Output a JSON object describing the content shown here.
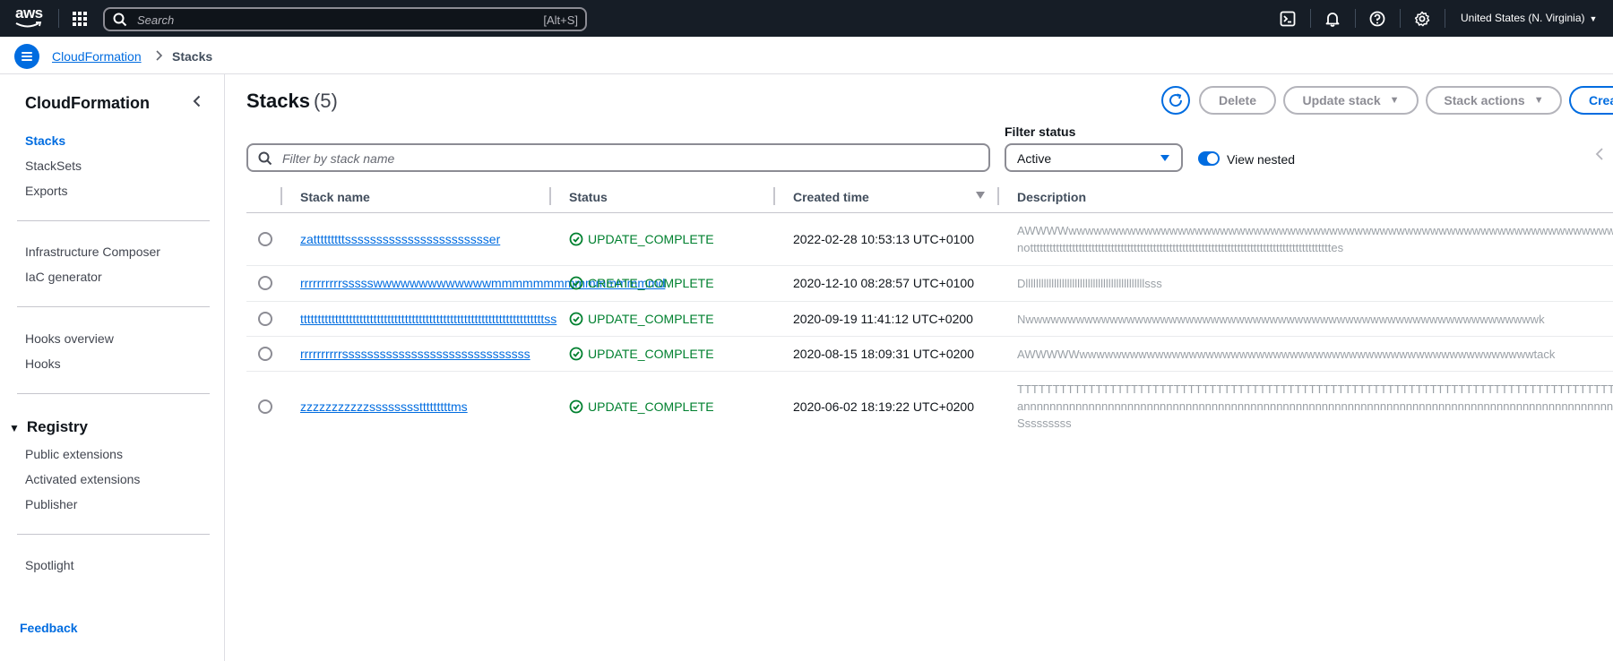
{
  "nav": {
    "logo": "aws",
    "search_placeholder": "Search",
    "search_shortcut": "[Alt+S]",
    "region": "United States (N. Virginia)",
    "icons": [
      "apps-grid-icon",
      "search-icon",
      "cloudshell-icon",
      "notifications-icon",
      "help-icon",
      "settings-icon"
    ]
  },
  "breadcrumb": {
    "items": [
      "CloudFormation",
      "Stacks"
    ]
  },
  "sidebar": {
    "title": "CloudFormation",
    "items": [
      "Stacks",
      "StackSets",
      "Exports"
    ],
    "group2": [
      "Infrastructure Composer",
      "IaC generator"
    ],
    "group3": [
      "Hooks overview",
      "Hooks"
    ],
    "registry": {
      "label": "Registry",
      "items": [
        "Public extensions",
        "Activated extensions",
        "Publisher"
      ]
    },
    "group5": [
      "Spotlight"
    ],
    "feedback": "Feedback"
  },
  "main": {
    "title": "Stacks",
    "count": "(5)",
    "buttons": {
      "delete": "Delete",
      "update": "Update stack",
      "actions": "Stack actions",
      "create": "Crea"
    },
    "filter": {
      "placeholder": "Filter by stack name",
      "status_label": "Filter status",
      "status_value": "Active",
      "view_nested": "View nested"
    },
    "columns": [
      "Stack name",
      "Status",
      "Created time",
      "Description"
    ],
    "rows": [
      {
        "name": "zatttttttttssssssssssssssssssssssser",
        "status": "UPDATE_COMPLETE",
        "created": "2022-02-28 10:53:13 UTC+0100",
        "desc": [
          "AWWWWwwwwwwwwwwwwwwwwwwwwwwwwwwwwwwwwwwwwwwwwwwwwwwwwwwwwwwwwwwwwwwwwwwwwwwwwwwwwwwwwwwwwwwwwwwwwwwwwv",
          "notttttttttttttttttttttttttttttttttttttttttttttttttttttttttttttttttttttttttttttttttttttttttttttes"
        ]
      },
      {
        "name": "rrrrrrrrrrssssswwwwwwwwwwwwwmmmmmmmmmmmmmmmmd",
        "status": "CREATE_COMPLETE",
        "created": "2020-12-10 08:28:57 UTC+0100",
        "desc": [
          "Dllllllllllllllllllllllllllllllllllllllllllllllsss"
        ]
      },
      {
        "name": "ttttttttttttttttttttttttttttttttttttttttttttttttttttttttttttttttttttttss",
        "status": "UPDATE_COMPLETE",
        "created": "2020-09-19 11:41:12 UTC+0200",
        "desc": [
          "Nwwwwwwwwwwwwwwwwwwwwwwwwwwwwwwwwwwwwwwwwwwwwwwwwwwwwwwwwwwwwwk"
        ]
      },
      {
        "name": "rrrrrrrrrrssssssssssssssssssssssssssssss",
        "status": "UPDATE_COMPLETE",
        "created": "2020-08-15 18:09:31 UTC+0200",
        "desc": [
          "AWWWWWwwwwwwwwwwwwwwwwwwwwwwwwwwwwwwwwwwwwwwwwwwwwwwwwwwwwwwtack"
        ]
      },
      {
        "name": "zzzzzzzzzzzsssssssstttttttttms",
        "status": "UPDATE_COMPLETE",
        "created": "2020-06-02 18:19:22 UTC+0200",
        "desc": [
          "TTTTTTTTTTTTTTTTTTTTTTTTTTTTTTTTTTTTTTTTTTTTTTTTTTTTTTTTTTTTTTTTTTTTTTTTTTTTTTTTTTTTTTTTTTTTTTTTTcan",
          "annnnnnnnnnnnnnnnnnnnnnnnnnnnnnnnnnnnnnnnnnnnnnnnnnnnnnnnnnnnnnnnnnnnnnnnnnnnnnnnnnnnnnnnnnnnnnnn",
          "Sssssssss"
        ]
      }
    ]
  },
  "colors": {
    "accent": "#006ce0",
    "success": "#00802f",
    "topbar": "#161d26"
  }
}
